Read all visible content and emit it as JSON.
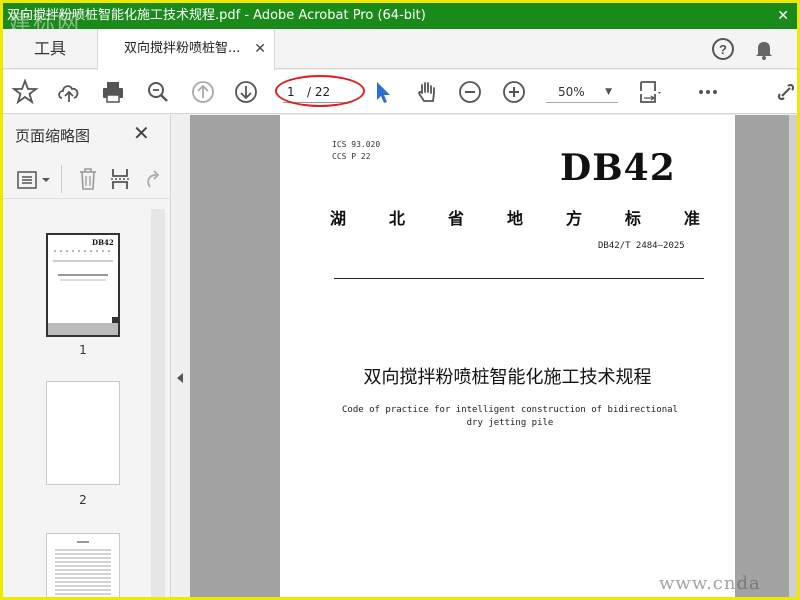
{
  "window": {
    "title": "双向搅拌粉喷桩智能化施工技术规程.pdf - Adobe Acrobat Pro (64-bit)",
    "close": "✕"
  },
  "watermark": {
    "top": "建标网",
    "bottom": "www.cnda"
  },
  "tabs": {
    "tools": "工具",
    "doc": "双向搅拌粉喷桩智...",
    "doc_close": "✕"
  },
  "header_icons": {
    "help": "?",
    "bell": "bell-icon"
  },
  "toolbar": {
    "page_current": "1",
    "page_total": "/ 22",
    "zoom": "50%",
    "zoom_arrow": "▼"
  },
  "sidebar": {
    "title": "页面缩略图",
    "close": "✕",
    "pages": [
      "1",
      "2"
    ]
  },
  "document": {
    "ics": "ICS  93.020",
    "ccs": "CCS  P 22",
    "code": "DB42",
    "province": [
      "湖",
      "北",
      "省",
      "地",
      "方",
      "标",
      "准"
    ],
    "standard_no": "DB42/T 2484—2025",
    "title_cn": "双向搅拌粉喷桩智能化施工技术规程",
    "title_en_1": "Code of practice for intelligent construction of bidirectional",
    "title_en_2": "dry jetting pile"
  },
  "colors": {
    "titlebar": "#1a8a1a",
    "frame": "#f0e800",
    "highlight": "#e02020",
    "cursor": "#2a6fd6"
  }
}
